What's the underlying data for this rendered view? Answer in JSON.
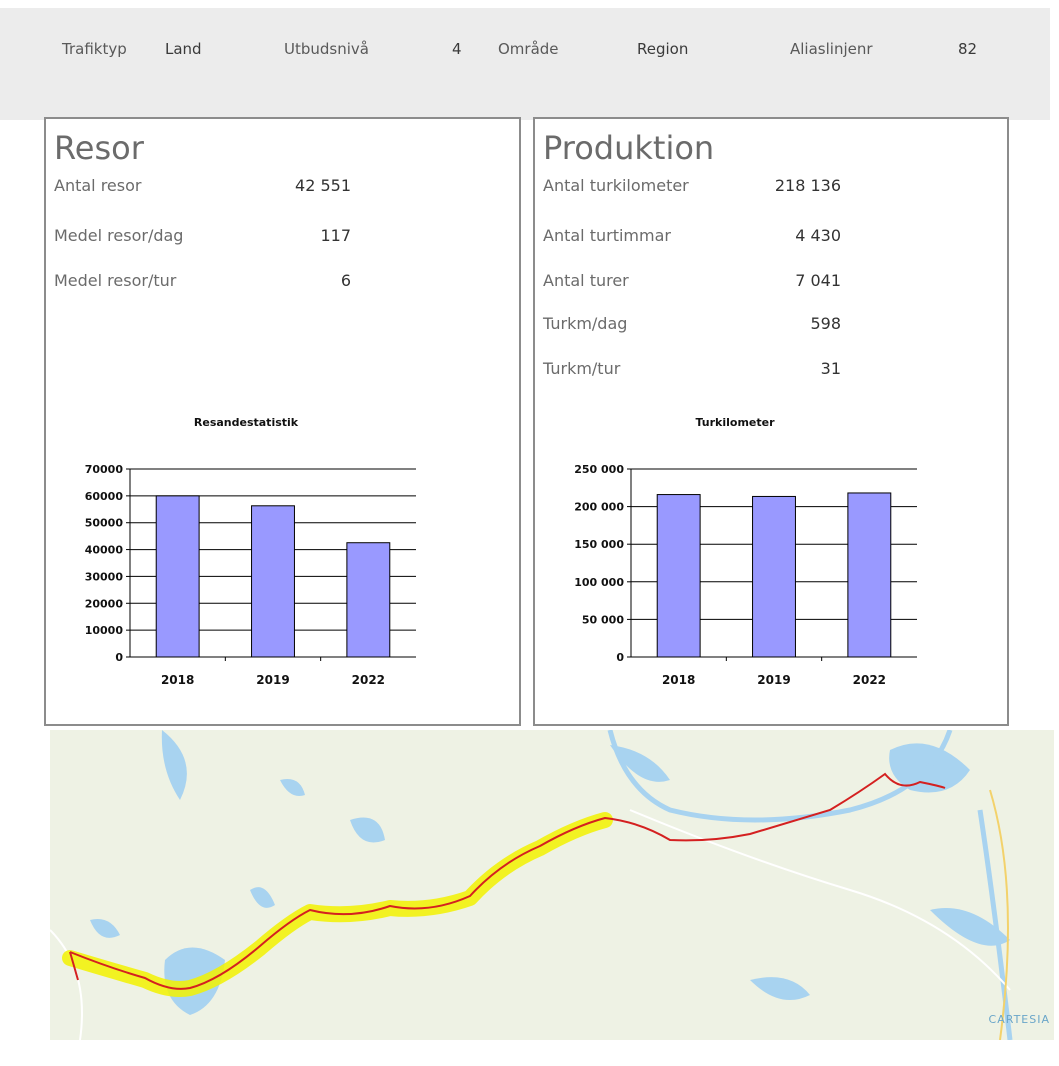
{
  "header": {
    "trafiktyp_label": "Trafiktyp",
    "trafiktyp_value": "Land",
    "utbudsniva_label": "Utbudsnivå",
    "utbudsniva_value": "4",
    "omrade_label": "Område",
    "omrade_value": "Region",
    "aliaslinjenr_label": "Aliaslinjenr",
    "aliaslinjenr_value": "82"
  },
  "resor": {
    "title": "Resor",
    "stats": [
      {
        "label": "Antal resor",
        "value": "42 551"
      },
      {
        "label": "Medel resor/dag",
        "value": "117"
      },
      {
        "label": "Medel resor/tur",
        "value": "6"
      }
    ]
  },
  "produktion": {
    "title": "Produktion",
    "stats": [
      {
        "label": "Antal turkilometer",
        "value": "218 136"
      },
      {
        "label": "Antal turtimmar",
        "value": "4 430"
      },
      {
        "label": "Antal turer",
        "value": "7 041"
      },
      {
        "label": "Turkm/dag",
        "value": "598"
      },
      {
        "label": "Turkm/tur",
        "value": "31"
      }
    ]
  },
  "chart_data": [
    {
      "type": "bar",
      "title": "Resandestatistik",
      "categories": [
        "2018",
        "2019",
        "2022"
      ],
      "values": [
        60000,
        56300,
        42551
      ],
      "ylim": [
        0,
        70000
      ],
      "yticks": [
        0,
        10000,
        20000,
        30000,
        40000,
        50000,
        60000,
        70000
      ],
      "ytick_labels": [
        "0",
        "10000",
        "20000",
        "30000",
        "40000",
        "50000",
        "60000",
        "70000"
      ],
      "grid": true,
      "bar_color": "#9999ff"
    },
    {
      "type": "bar",
      "title": "Turkilometer",
      "categories": [
        "2018",
        "2019",
        "2022"
      ],
      "values": [
        216000,
        213500,
        218136
      ],
      "ylim": [
        0,
        250000
      ],
      "yticks": [
        0,
        50000,
        100000,
        150000,
        200000,
        250000
      ],
      "ytick_labels": [
        "0",
        "50 000",
        "100 000",
        "150 000",
        "200 000",
        "250 000"
      ],
      "grid": true,
      "bar_color": "#9999ff"
    }
  ],
  "map": {
    "watermark": "CARTESIA",
    "route_color": "#d42020",
    "highlight_color": "#f2f200"
  }
}
